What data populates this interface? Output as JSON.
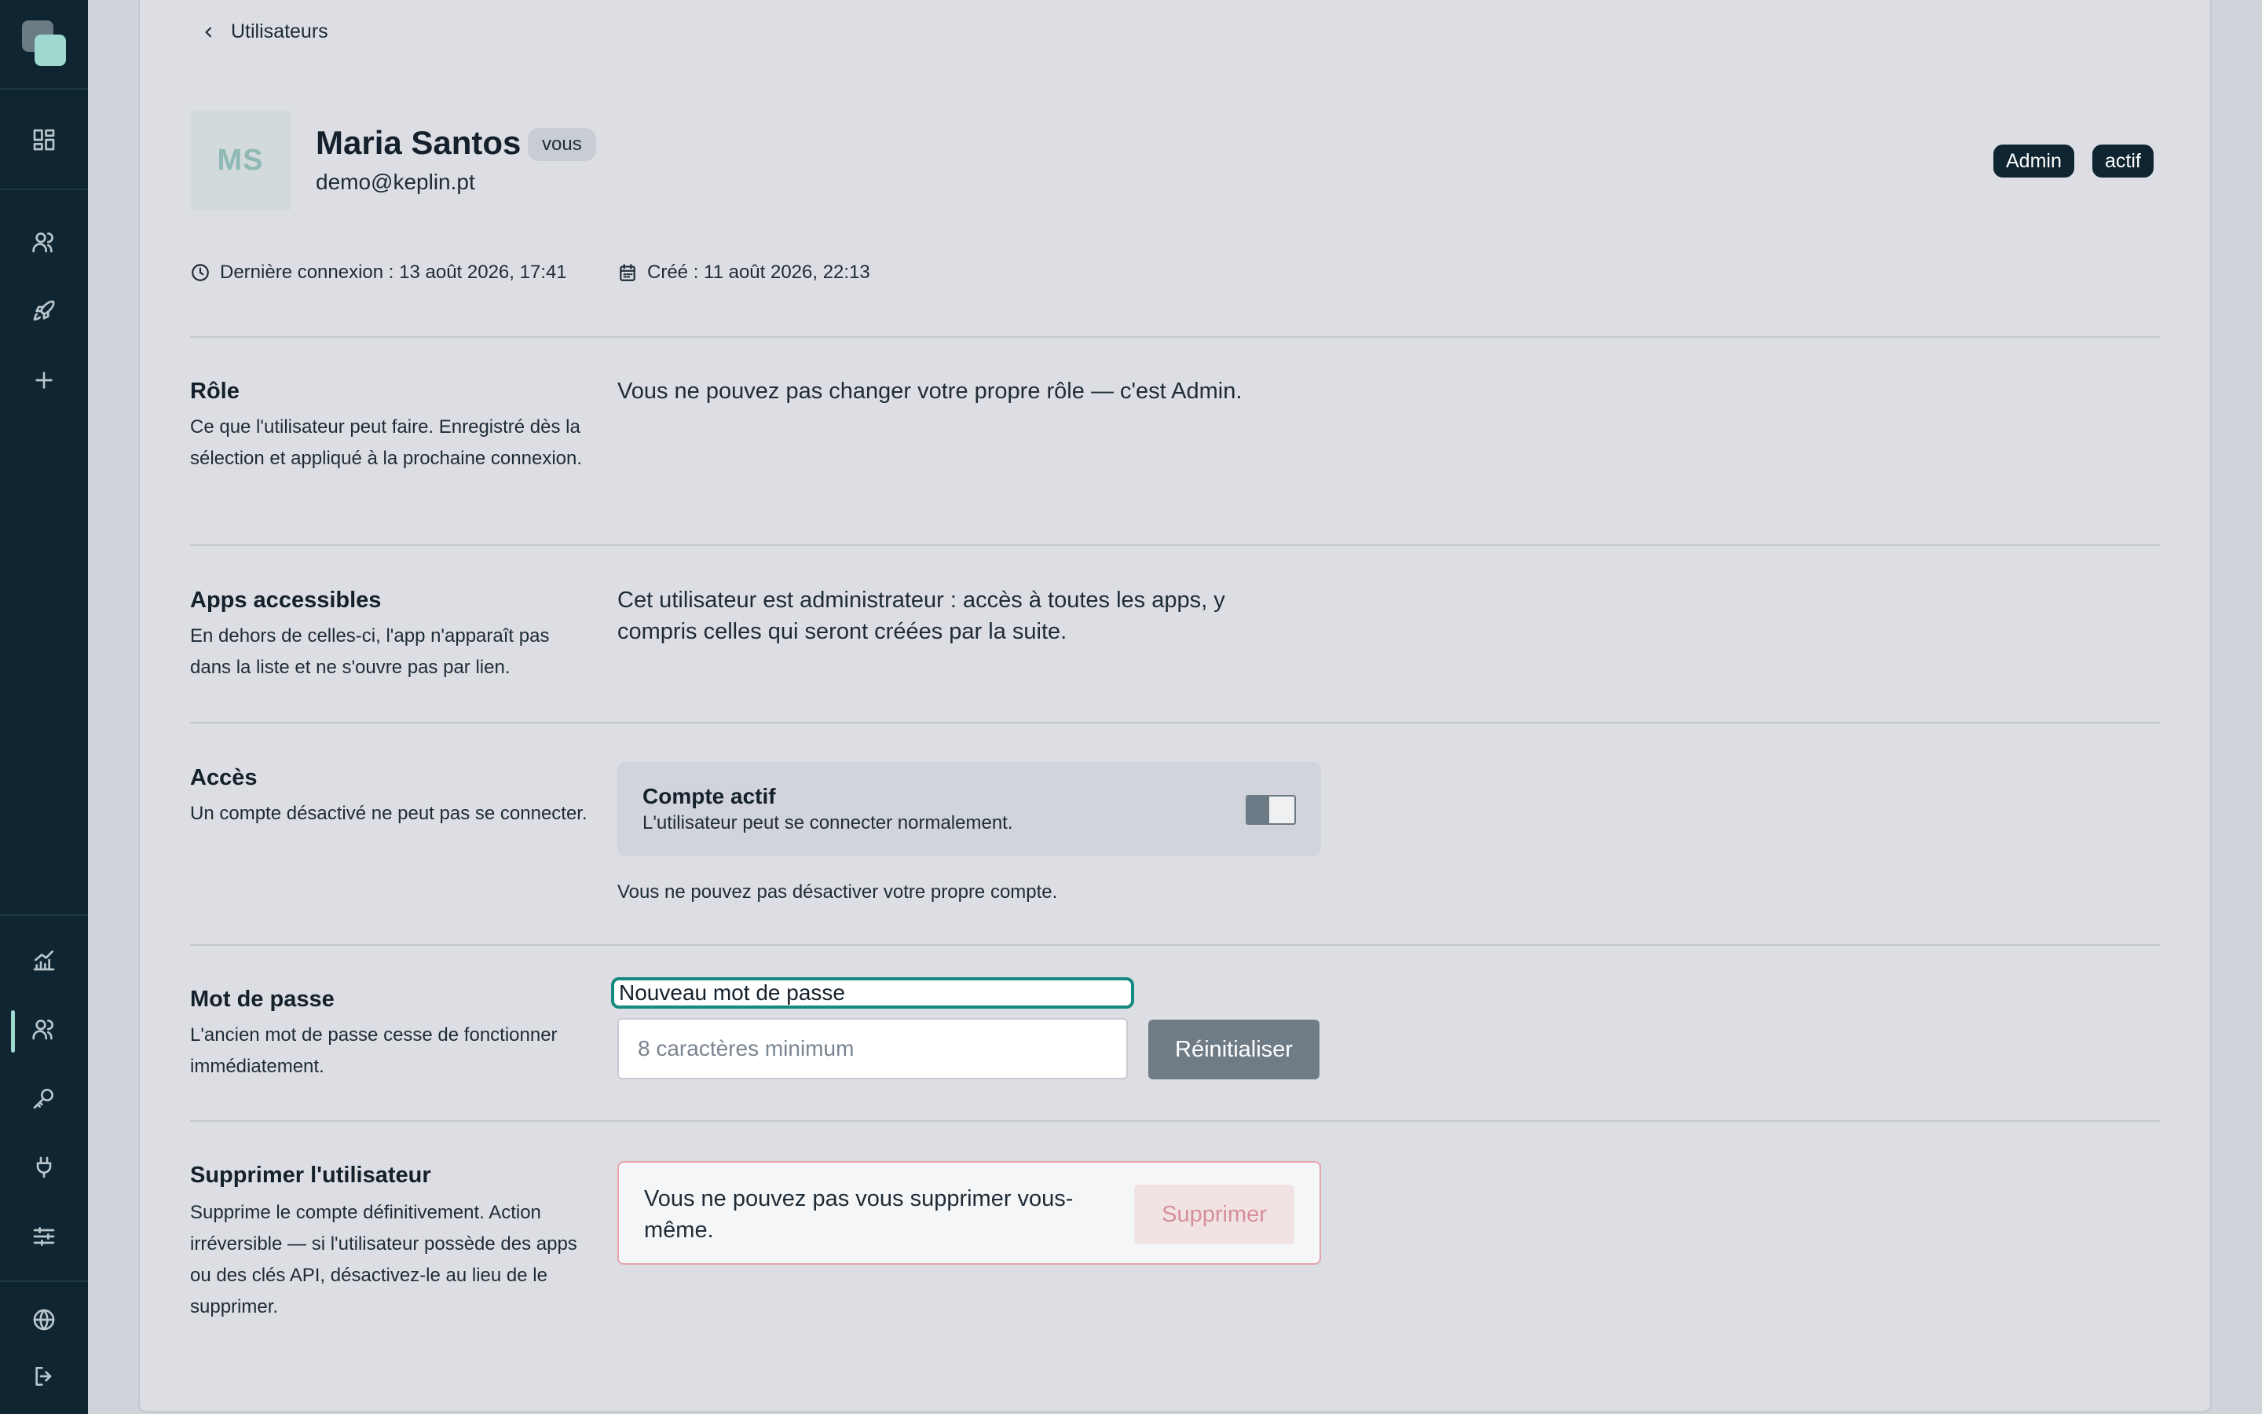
{
  "nav": {
    "back_label": "Utilisateurs"
  },
  "user": {
    "initials": "MS",
    "name": "Maria Santos",
    "you_badge": "vous",
    "email": "demo@keplin.pt",
    "role_badge": "Admin",
    "status_badge": "actif",
    "last_login": "Dernière connexion : 13 août 2026, 17:41",
    "created": "Créé : 11 août 2026, 22:13"
  },
  "sections": {
    "role": {
      "title": "Rôle",
      "desc": "Ce que l'utilisateur peut faire. Enregistré dès la sélection et appliqué à la prochaine connexion.",
      "body": "Vous ne pouvez pas changer votre propre rôle — c'est Admin."
    },
    "apps": {
      "title": "Apps accessibles",
      "desc": "En dehors de celles-ci, l'app n'apparaît pas dans la liste et ne s'ouvre pas par lien.",
      "body": "Cet utilisateur est administrateur : accès à toutes les apps, y compris celles qui seront créées par la suite."
    },
    "access": {
      "title": "Accès",
      "desc": "Un compte désactivé ne peut pas se connecter.",
      "toggle_title": "Compte actif",
      "toggle_sub": "L'utilisateur peut se connecter normalement.",
      "note": "Vous ne pouvez pas désactiver votre propre compte."
    },
    "password": {
      "title": "Mot de passe",
      "desc": "L'ancien mot de passe cesse de fonctionner immédiatement.",
      "field_label": "Nouveau mot de passe",
      "placeholder": "8 caractères minimum",
      "button": "Réinitialiser"
    },
    "delete": {
      "title": "Supprimer l'utilisateur",
      "desc": "Supprime le compte définitivement. Action irréversible — si l'utilisateur possède des apps ou des clés API, désactivez-le au lieu de le supprimer.",
      "text": "Vous ne pouvez pas vous supprimer vous-même.",
      "button": "Supprimer"
    }
  },
  "sidebar_icons": [
    "grid-icon",
    "users-icon",
    "rocket-icon",
    "plus-icon",
    "chart-icon",
    "users-icon",
    "key-icon",
    "plug-icon",
    "sliders-icon",
    "globe-icon",
    "logout-icon"
  ],
  "colors": {
    "sidebar": "#0f2531",
    "accent": "#9ed8cf",
    "focus": "#168a7f",
    "danger": "#e4a5ab"
  }
}
